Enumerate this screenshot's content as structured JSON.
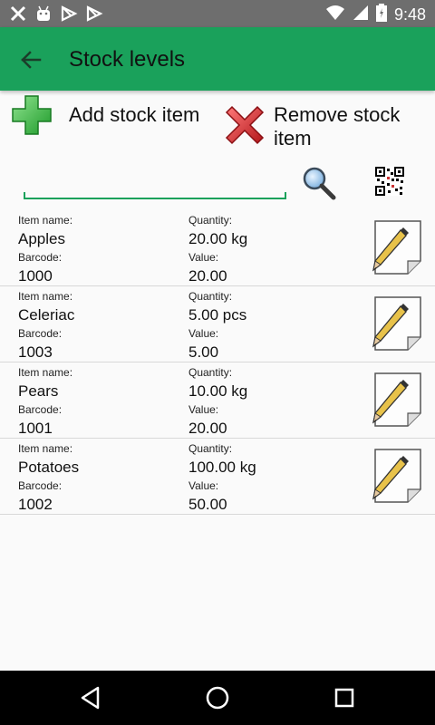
{
  "status_bar": {
    "time": "9:48"
  },
  "app_bar": {
    "title": "Stock levels"
  },
  "actions": {
    "add_label": "Add stock item",
    "remove_label": "Remove stock item"
  },
  "search": {
    "value": "",
    "placeholder": ""
  },
  "labels": {
    "item_name": "Item name:",
    "quantity": "Quantity:",
    "barcode": "Barcode:",
    "value": "Value:"
  },
  "items": [
    {
      "name": "Apples",
      "quantity": "20.00 kg",
      "barcode": "1000",
      "value": "20.00"
    },
    {
      "name": "Celeriac",
      "quantity": "5.00 pcs",
      "barcode": "1003",
      "value": "5.00"
    },
    {
      "name": "Pears",
      "quantity": "10.00 kg",
      "barcode": "1001",
      "value": "20.00"
    },
    {
      "name": "Potatoes",
      "quantity": "100.00 kg",
      "barcode": "1002",
      "value": "50.00"
    }
  ],
  "colors": {
    "app_bar": "#1aa15b",
    "status_bar": "#6e6e6e",
    "nav_bar": "#000000",
    "add_icon": "#3cb93c",
    "remove_icon": "#d9262a"
  },
  "icons": {
    "back": "arrow-left-icon",
    "add": "plus-icon",
    "remove": "x-icon",
    "search": "magnifier-icon",
    "qr": "qr-code-icon",
    "edit": "pencil-paper-icon"
  }
}
